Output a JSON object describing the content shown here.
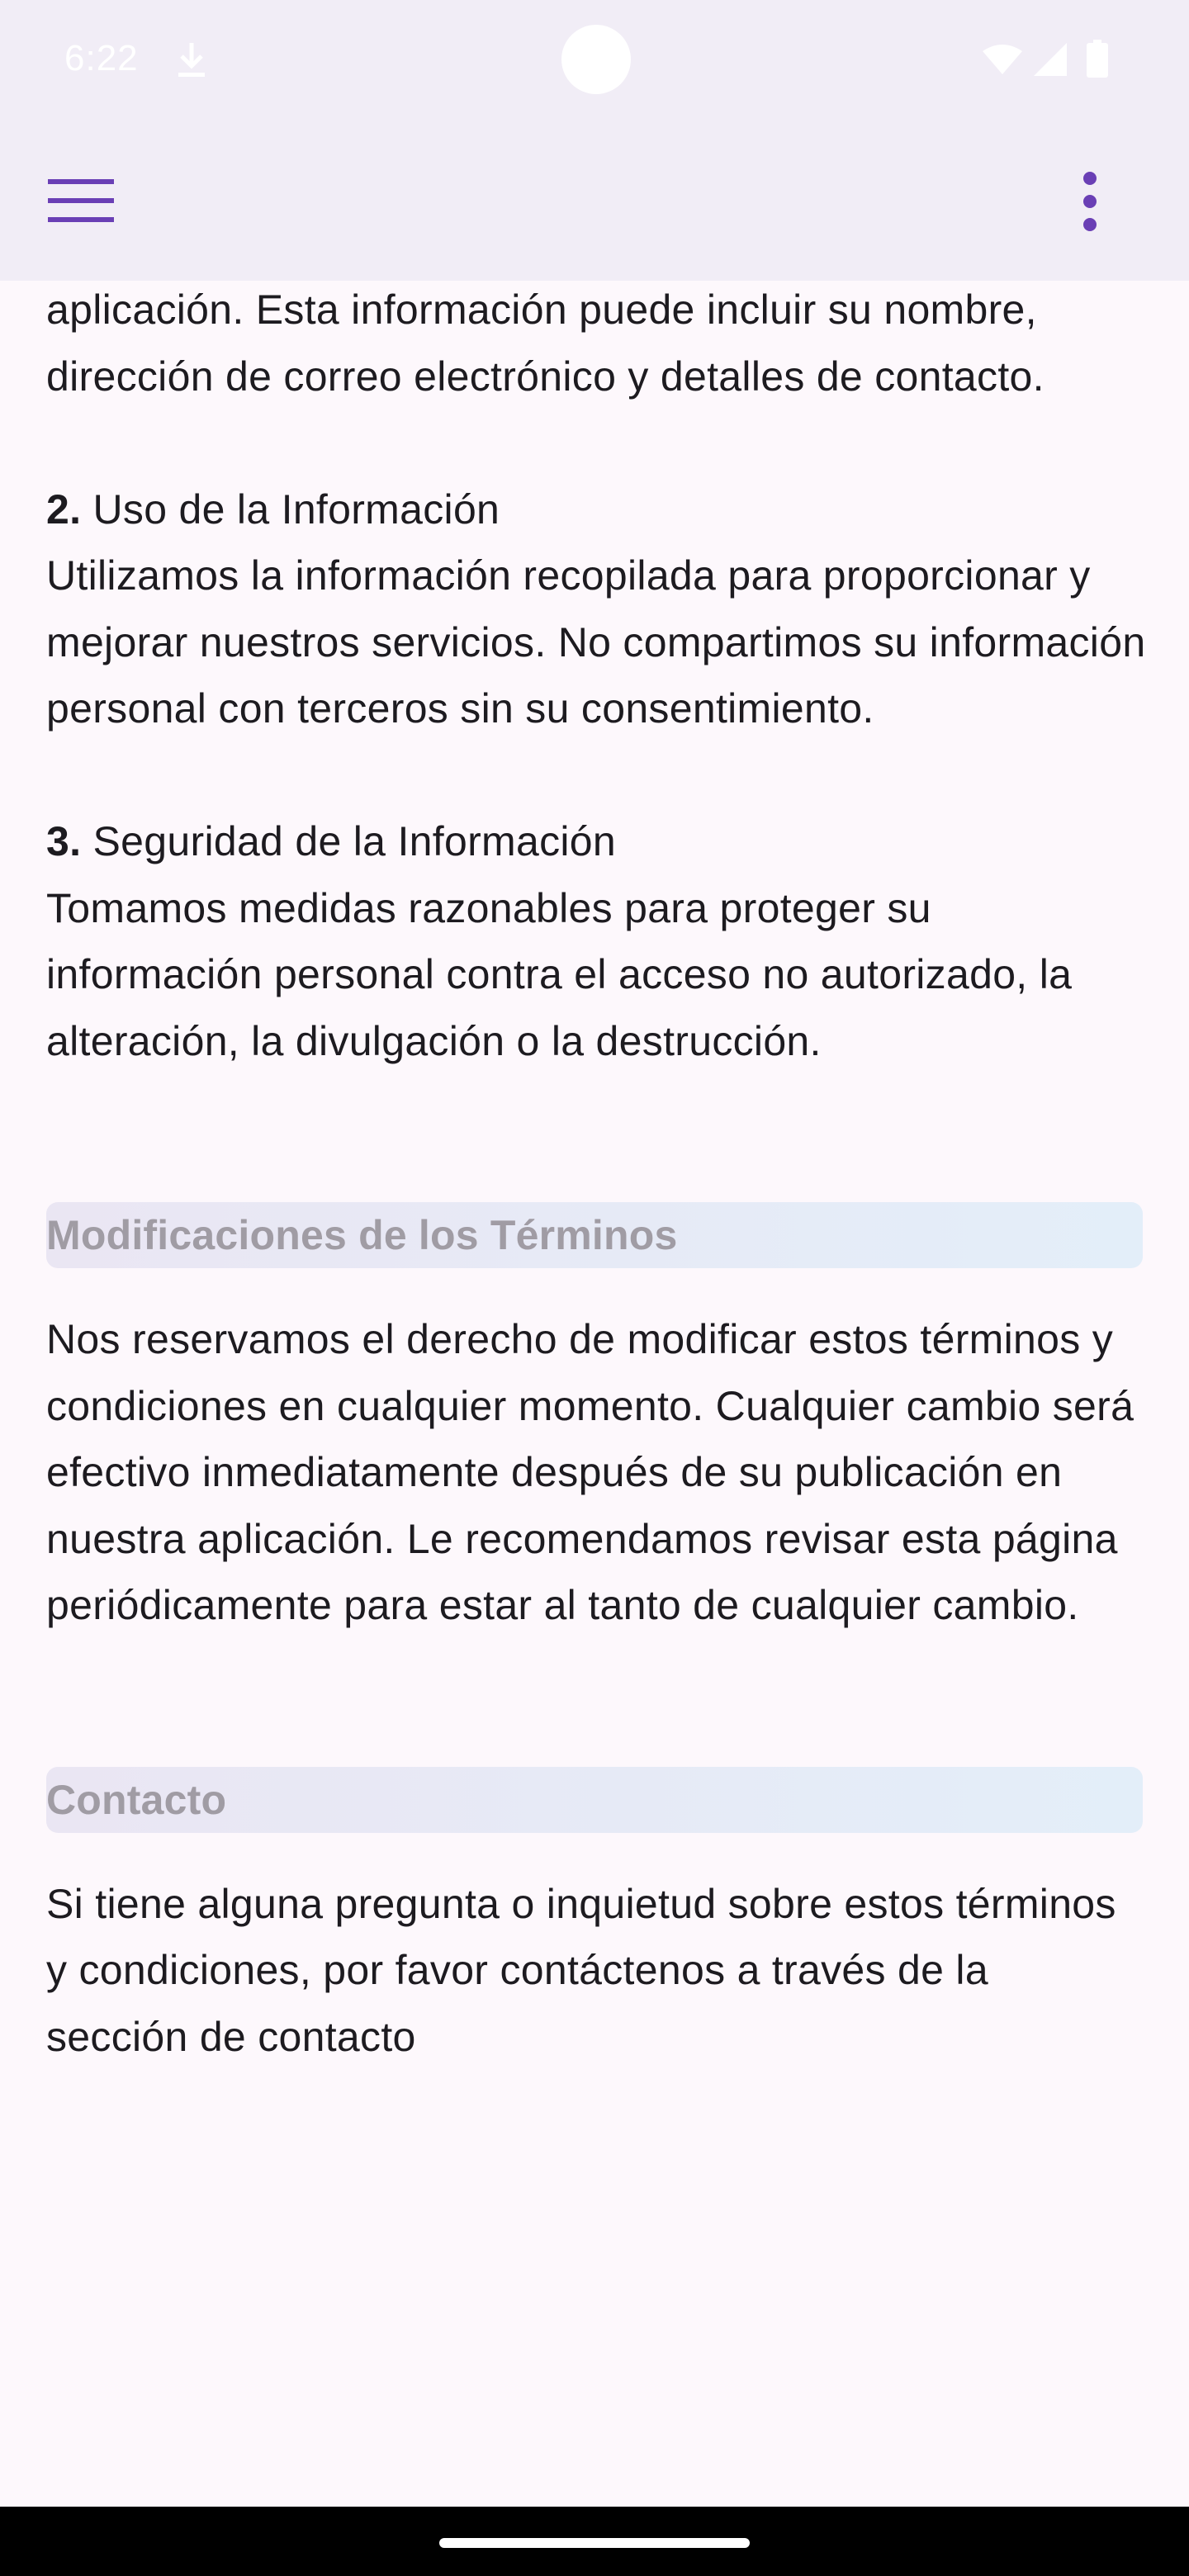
{
  "status_bar": {
    "time": "6:22",
    "icons": [
      "download-icon",
      "wifi-icon",
      "signal-icon",
      "battery-icon"
    ]
  },
  "app_bar": {
    "left_icon": "menu-icon",
    "right_icon": "more-vert-icon"
  },
  "content": {
    "intro_paragraph": "aplicación. Esta información puede incluir su nombre, dirección de correo electrónico y detalles de contacto.",
    "item2": {
      "number": "2.",
      "title": "Uso de la Información",
      "body": "Utilizamos la información recopilada para proporcionar y mejorar nuestros servicios. No compartimos su información personal con terceros sin su consentimiento."
    },
    "item3": {
      "number": "3.",
      "title": "Seguridad de la Información",
      "body": "Tomamos medidas razonables para proteger su información personal contra el acceso no autorizado, la alteración, la divulgación o la destrucción."
    },
    "modifications": {
      "header": "Modificaciones de los Términos",
      "body": "Nos reservamos el derecho de modificar estos términos y condiciones en cualquier momento. Cualquier cambio será efectivo inmediatamente después de su publicación en nuestra aplicación. Le recomendamos revisar esta página periódicamente para estar al tanto de cualquier cambio."
    },
    "contact": {
      "header": "Contacto",
      "body": "Si tiene alguna pregunta o inquietud sobre estos términos y condiciones, por favor contáctenos a través de la sección de contacto"
    }
  },
  "colors": {
    "accent": "#6a3fb5",
    "background": "#fdf8fc",
    "app_bar": "#f1edf6",
    "section_header_text": "#a09ca4"
  }
}
